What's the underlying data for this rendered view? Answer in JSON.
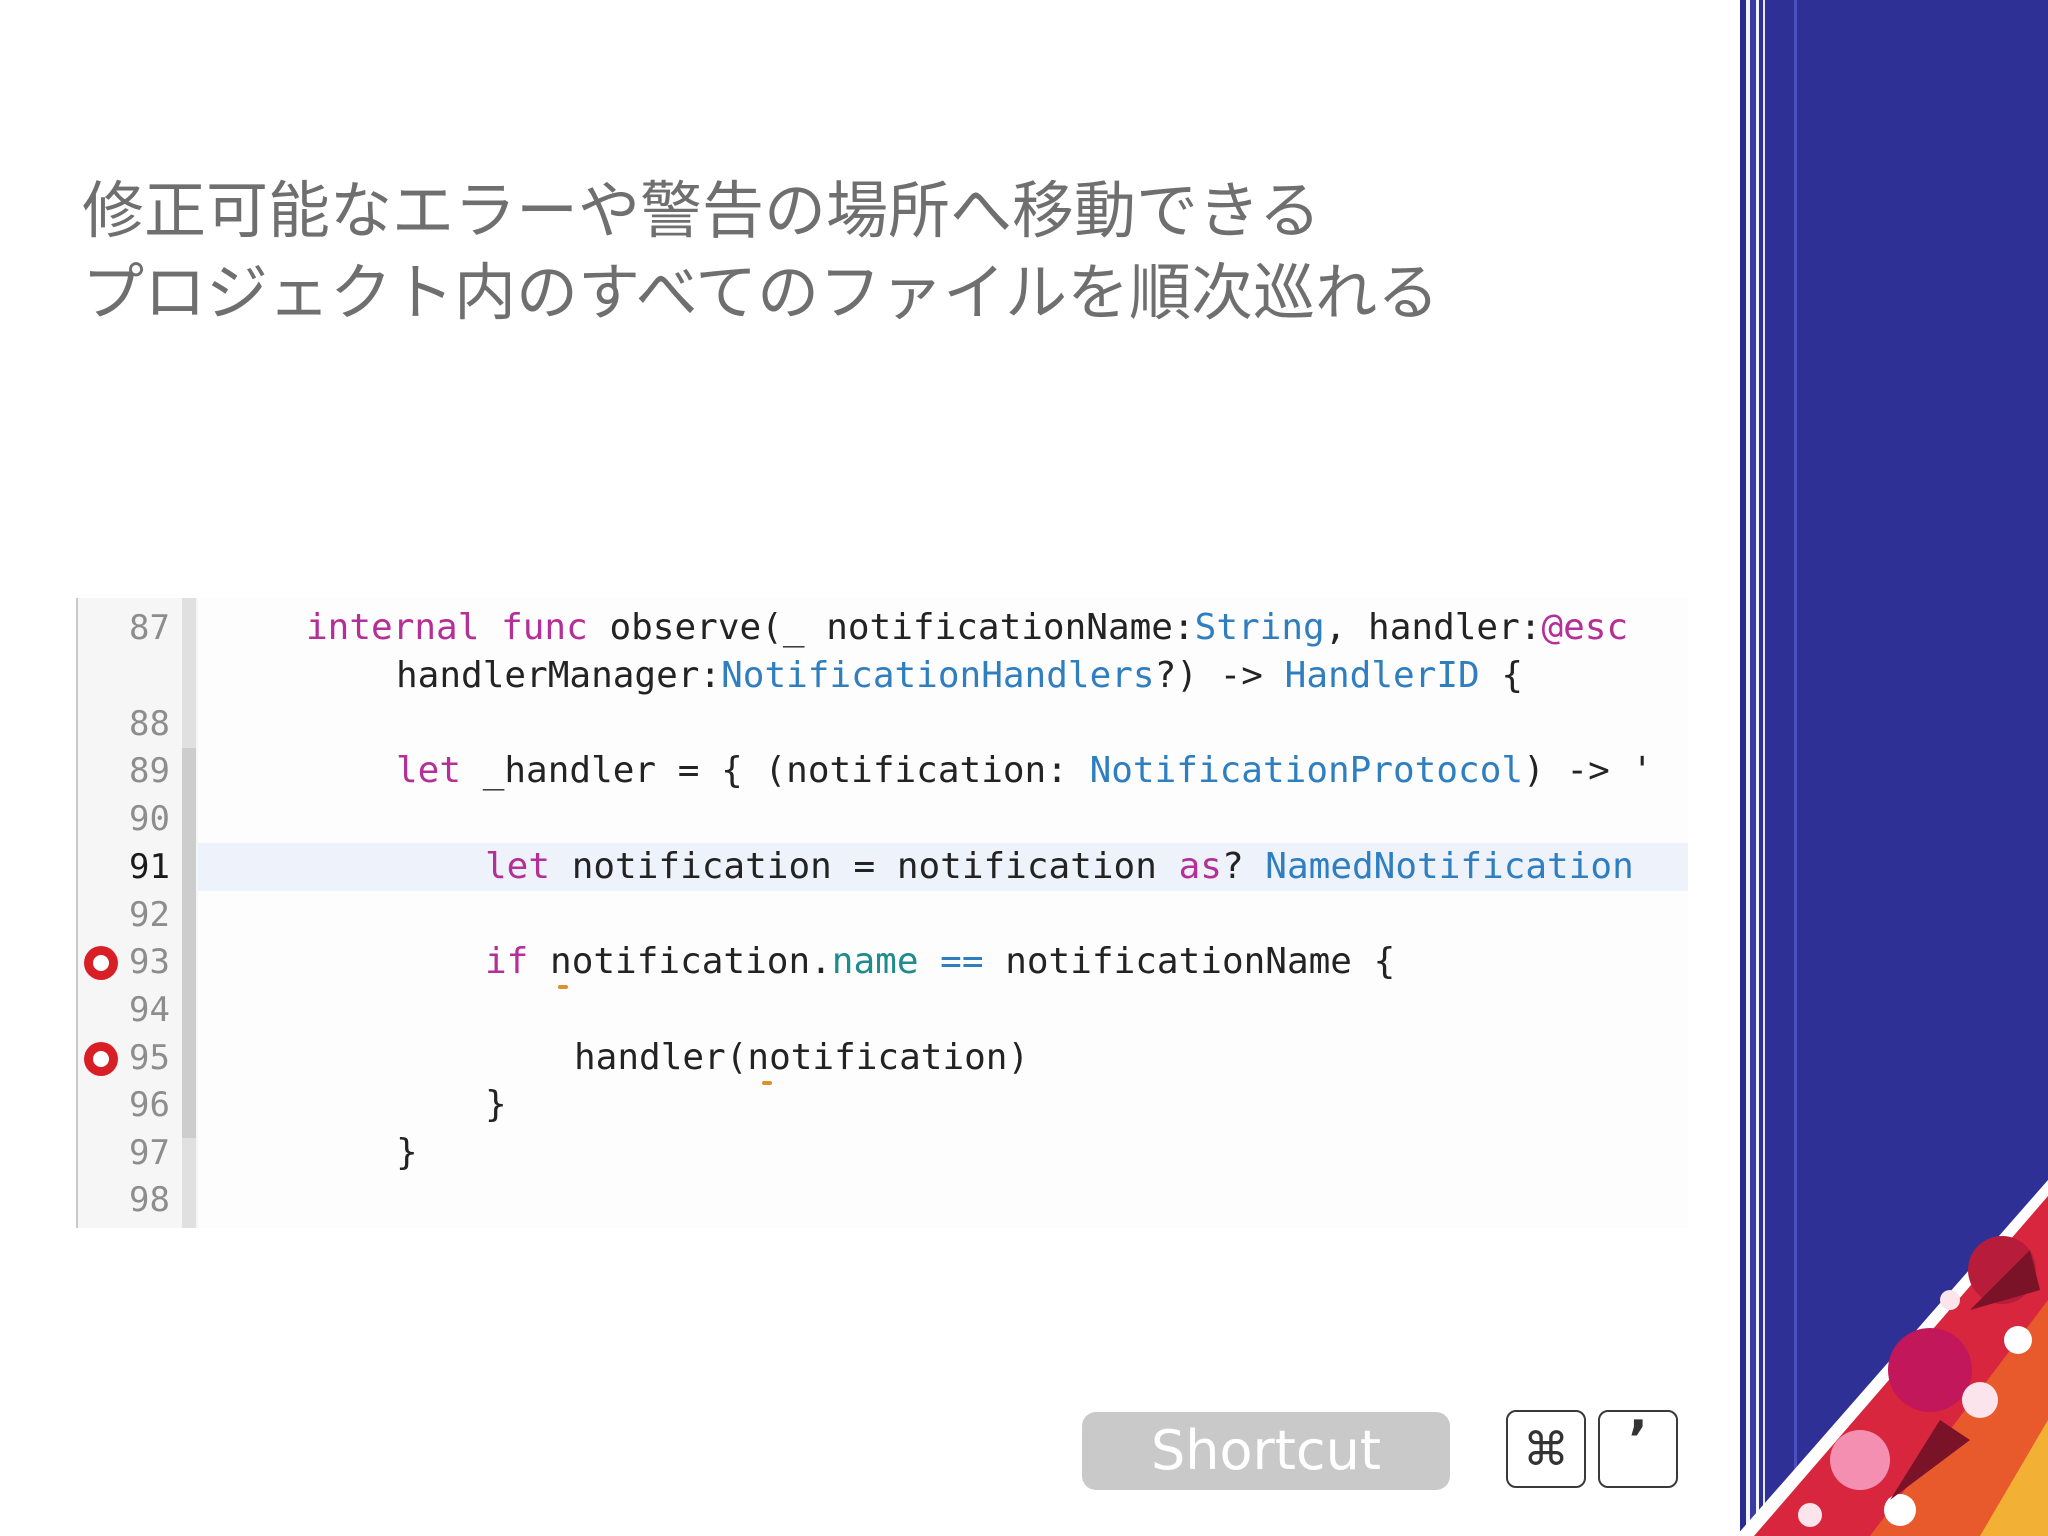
{
  "slide": {
    "heading_line1": "修正可能なエラーや警告の場所へ移動できる",
    "heading_line2": "プロジェクト内のすべてのファイルを順次巡れる"
  },
  "editor": {
    "line_numbers": [
      "87",
      "88",
      "89",
      "90",
      "91",
      "92",
      "93",
      "94",
      "95",
      "96",
      "97",
      "98"
    ],
    "current_line": "91",
    "breakpoint_lines": [
      "93",
      "95"
    ],
    "code": {
      "l87a_kw1": "internal",
      "l87a_kw2": "func",
      "l87a_t1": " observe(_ notificationName:",
      "l87a_ty1": "String",
      "l87a_t2": ", handler:",
      "l87a_kw3": "@esc",
      "l87b_t1": "handlerManager:",
      "l87b_ty1": "NotificationHandlers",
      "l87b_t2": "?) -> ",
      "l87b_ty2": "HandlerID",
      "l87b_t3": " {",
      "l89_kw1": "let",
      "l89_t1": " _handler = { (notification: ",
      "l89_ty1": "NotificationProtocol",
      "l89_t2": ") -> '",
      "l91_kw1": "let",
      "l91_t1": " notification = notification ",
      "l91_kw2": "as",
      "l91_t2": "? ",
      "l91_ty1": "NamedNotification",
      "l93_kw1": "if",
      "l93_t1": " notification.",
      "l93_pr1": "name",
      "l93_op": " == ",
      "l93_t2": "notificationName {",
      "l95_t1": "handler(notification)",
      "l96_t1": "}",
      "l97_t1": "}"
    }
  },
  "shortcut": {
    "label": "Shortcut",
    "key1": "⌘",
    "key2": "’"
  },
  "colors": {
    "keyword": "#b42f98",
    "type": "#2f7fc0",
    "property": "#1f8b8b",
    "breakpoint": "#d81f26",
    "band": "#2f3096"
  }
}
